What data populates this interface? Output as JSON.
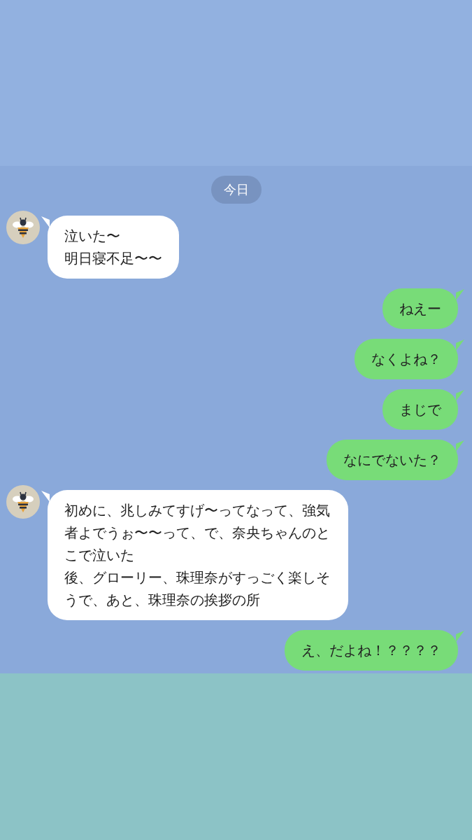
{
  "date_label": "今日",
  "messages": [
    {
      "kind": "incoming",
      "paragraphs": [
        "泣いた〜",
        "明日寝不足〜〜"
      ]
    },
    {
      "kind": "outgoing",
      "paragraphs": [
        "ねえー"
      ]
    },
    {
      "kind": "outgoing",
      "paragraphs": [
        "なくよね？"
      ]
    },
    {
      "kind": "outgoing",
      "paragraphs": [
        "まじで"
      ]
    },
    {
      "kind": "outgoing",
      "paragraphs": [
        "なにでないた？"
      ]
    },
    {
      "kind": "incoming",
      "paragraphs": [
        "初めに、兆しみてすげ〜ってなって、強気者よでうぉ〜〜って、で、奈央ちゃんのとこで泣いた",
        "後、グローリー、珠理奈がすっごく楽しそうで、あと、珠理奈の挨拶の所"
      ]
    },
    {
      "kind": "outgoing",
      "paragraphs": [
        "え、だよね！？？？？"
      ]
    }
  ]
}
